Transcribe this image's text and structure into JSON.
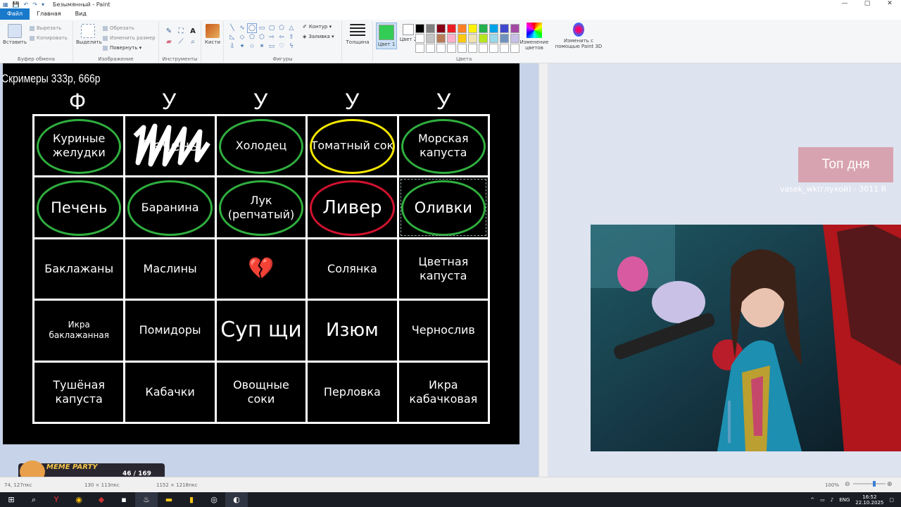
{
  "window": {
    "title": "Безымянный - Paint"
  },
  "menu": {
    "tabs": [
      "Файл",
      "Главная",
      "Вид"
    ]
  },
  "ribbon": {
    "clipboard": {
      "paste": "Вставить",
      "cut": "Вырезать",
      "copy": "Копировать",
      "group": "Буфер обмена"
    },
    "image": {
      "select": "Выделить",
      "crop": "Обрезать",
      "resize": "Изменить размер",
      "rotate": "Повернуть ▾",
      "group": "Изображение"
    },
    "tools": {
      "group": "Инструменты"
    },
    "brushes": {
      "label": "Кисти"
    },
    "shapes": {
      "outline": "Контур ▾",
      "fill": "Заливка ▾",
      "group": "Фигуры"
    },
    "size": {
      "label": "Толщина"
    },
    "colors": {
      "color1": "Цвет 1",
      "color2": "Цвет 2",
      "edit": "Изменение цветов",
      "paint3d": "Изменить с помощью Paint 3D",
      "group": "Цвета",
      "color1_value": "#33cc55",
      "color2_value": "#ffffff",
      "palette": [
        "#000000",
        "#7f7f7f",
        "#880015",
        "#ed1c24",
        "#ff7f27",
        "#fff200",
        "#22b14c",
        "#00a2e8",
        "#3f48cc",
        "#a349a4",
        "#ffffff",
        "#c3c3c3",
        "#b97a57",
        "#ffaec9",
        "#ffc90e",
        "#efe4b0",
        "#b5e61d",
        "#99d9ea",
        "#7092be",
        "#c8bfe7",
        "#ffffff",
        "#ffffff",
        "#ffffff",
        "#ffffff",
        "#ffffff",
        "#ffffff",
        "#ffffff",
        "#ffffff",
        "#ffffff",
        "#ffffff"
      ]
    }
  },
  "bingo": {
    "caption": "Скримеры 333р, 666р",
    "headers": [
      "Ф",
      "У",
      "У",
      "У",
      "У"
    ],
    "cells": [
      {
        "text": "Куриные желудки",
        "mark": "green"
      },
      {
        "text": "Печень",
        "mark": "scribble"
      },
      {
        "text": "Холодец",
        "mark": "green"
      },
      {
        "text": "Томатный сок",
        "mark": "yellow"
      },
      {
        "text": "Морская капуста",
        "mark": "green"
      },
      {
        "text": "Печень",
        "mark": "green"
      },
      {
        "text": "Баранина",
        "mark": "green"
      },
      {
        "text": "Лук (репчатый)",
        "mark": "green"
      },
      {
        "text": "Ливер",
        "mark": "red"
      },
      {
        "text": "Оливки",
        "mark": "green-selected"
      },
      {
        "text": "Баклажаны",
        "mark": ""
      },
      {
        "text": "Маслины",
        "mark": ""
      },
      {
        "text": "💔",
        "mark": "heart"
      },
      {
        "text": "Солянка",
        "mark": ""
      },
      {
        "text": "Цветная капуста",
        "mark": ""
      },
      {
        "text": "Икра баклажанная",
        "mark": ""
      },
      {
        "text": "Помидоры",
        "mark": ""
      },
      {
        "text": "Суп щи",
        "mark": ""
      },
      {
        "text": "Изюм",
        "mark": ""
      },
      {
        "text": "Чернослив",
        "mark": ""
      },
      {
        "text": "Тушёная капуста",
        "mark": ""
      },
      {
        "text": "Кабачки",
        "mark": ""
      },
      {
        "text": "Овощные соки",
        "mark": ""
      },
      {
        "text": "Перловка",
        "mark": ""
      },
      {
        "text": "Икра кабачковая",
        "mark": ""
      }
    ]
  },
  "stream": {
    "top_day": "Топ дня",
    "top_day_sub": "vasek_wk(глухой) - 3011 R",
    "meme_party": {
      "brand": "MEME PARTY",
      "count": "46 / 169"
    }
  },
  "status": {
    "cursor": "74, 127пкс",
    "selection": "130 × 113пкс",
    "canvas": "1152 × 1218пкс",
    "zoom": "100%"
  },
  "taskbar": {
    "lang": "ENG",
    "time": "16:52",
    "date": "22.10.2025"
  }
}
